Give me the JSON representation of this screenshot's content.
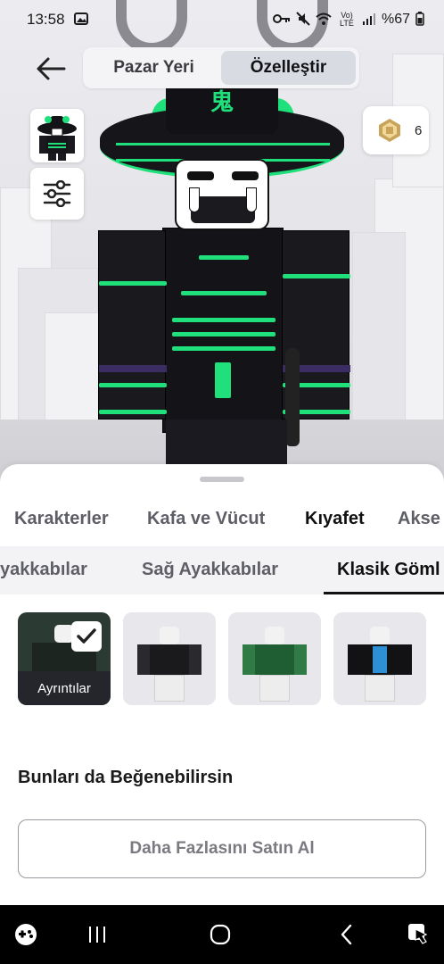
{
  "status_bar": {
    "time": "13:58",
    "battery_percent": "%67",
    "network_label": "Vo) LTE",
    "icons": [
      "image-icon",
      "key-icon",
      "mute-icon",
      "wifi-icon",
      "signal-icon",
      "battery-icon"
    ]
  },
  "header": {
    "segments": [
      {
        "label": "Pazar Yeri",
        "active": false
      },
      {
        "label": "Özelleştir",
        "active": true
      }
    ]
  },
  "robux": {
    "amount": "6"
  },
  "category_tabs": [
    "Karakterler",
    "Kafa ve Vücut",
    "Kıyafet",
    "Akse"
  ],
  "category_active": "Kıyafet",
  "subcategory_tabs": [
    "yakkabılar",
    "Sağ Ayakkabılar",
    "Klasik Göml"
  ],
  "subcategory_active": "Klasik Göml",
  "items": [
    {
      "selected": true,
      "details_label": "Ayrıntılar"
    },
    {
      "selected": false
    },
    {
      "selected": false
    },
    {
      "selected": false
    }
  ],
  "recommend_title": "Bunları da Beğenebilirsin",
  "buy_more_label": "Daha Fazlasını Satın Al",
  "colors": {
    "accent_green": "#1fe07a",
    "sheet_bg": "#ffffff",
    "dark_button": "#24262b"
  }
}
